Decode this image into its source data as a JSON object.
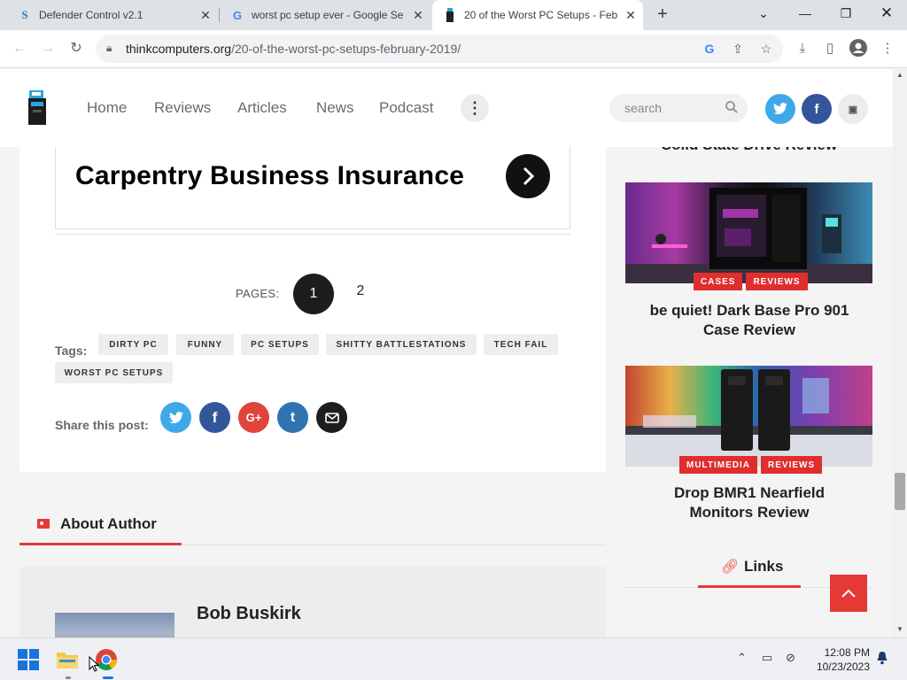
{
  "browser": {
    "tabs": [
      {
        "title": "Defender Control v2.1",
        "favicon": "S",
        "active": false
      },
      {
        "title": "worst pc setup ever - Google Se",
        "favicon": "G",
        "active": false
      },
      {
        "title": "20 of the Worst PC Setups - Feb",
        "favicon": "tc",
        "active": true
      }
    ],
    "url_domain": "thinkcomputers.org",
    "url_path": "/20-of-the-worst-pc-setups-february-2019/"
  },
  "site": {
    "menu": [
      "Home",
      "Reviews",
      "Articles",
      "News",
      "Podcast"
    ],
    "search_placeholder": "search",
    "social": [
      "twitter",
      "facebook",
      "youtube"
    ]
  },
  "article": {
    "ad_title": "Carpentry Business Insurance",
    "pages_label": "PAGES:",
    "pages": [
      "1",
      "2"
    ],
    "tags_label": "Tags:",
    "tags": [
      "DIRTY PC",
      "FUNNY",
      "PC SETUPS",
      "SHITTY BATTLESTATIONS",
      "TECH FAIL",
      "WORST PC SETUPS"
    ],
    "share_label": "Share this post:",
    "share": [
      "twitter",
      "facebook",
      "google-plus",
      "tumblr",
      "email"
    ]
  },
  "author": {
    "heading": "About Author",
    "name": "Bob Buskirk"
  },
  "sidebar": {
    "prev_title": "Solid State Drive Review",
    "cards": [
      {
        "badges": [
          "CASES",
          "REVIEWS"
        ],
        "title_line1": "be quiet! Dark Base Pro 901",
        "title_line2": "Case Review"
      },
      {
        "badges": [
          "MULTIMEDIA",
          "REVIEWS"
        ],
        "title_line1": "Drop BMR1 Nearfield",
        "title_line2": "Monitors Review"
      }
    ],
    "links_heading": "Links"
  },
  "taskbar": {
    "time": "12:08 PM",
    "date": "10/23/2023"
  },
  "colors": {
    "accent": "#e53935",
    "twitter": "#3fa9e8",
    "facebook": "#33569b",
    "google": "#e0443a",
    "tumblr": "#2f74b0",
    "email": "#1e1e1e"
  }
}
